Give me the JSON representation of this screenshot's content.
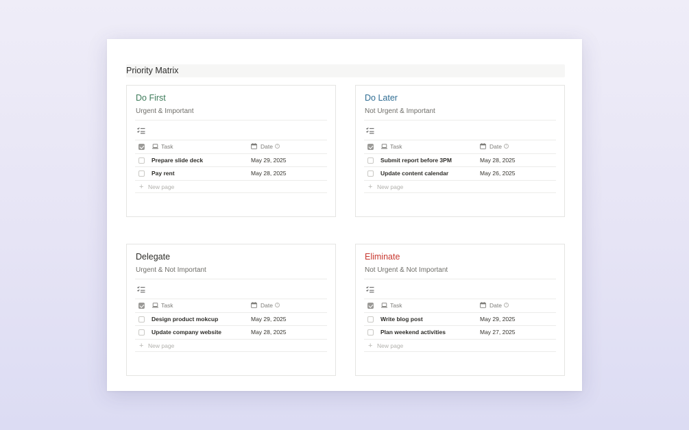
{
  "page": {
    "title": "Priority Matrix"
  },
  "colors": {
    "do_first": "#3c7a59",
    "do_later": "#2f6d93",
    "delegate": "#2d2c28",
    "eliminate": "#c8372f"
  },
  "icons": {
    "view": "list-checks-icon",
    "task_column": "laptop-icon",
    "date_column": "calendar-icon",
    "date_info": "info-icon",
    "new_page": "plus-icon"
  },
  "quadrants": [
    {
      "title": "Do First",
      "subtitle": "Urgent & Important",
      "header": {
        "task": "Task",
        "date": "Date"
      },
      "tasks": [
        {
          "name": "Prepare slide deck",
          "date": "May 29, 2025"
        },
        {
          "name": "Pay rent",
          "date": "May 28, 2025"
        }
      ],
      "new_page": "New page"
    },
    {
      "title": "Do Later",
      "subtitle": "Not Urgent & Important",
      "header": {
        "task": "Task",
        "date": "Date"
      },
      "tasks": [
        {
          "name": "Submit report before 3PM",
          "date": "May 28, 2025"
        },
        {
          "name": "Update content calendar",
          "date": "May 26, 2025"
        }
      ],
      "new_page": "New page"
    },
    {
      "title": "Delegate",
      "subtitle": "Urgent & Not Important",
      "header": {
        "task": "Task",
        "date": "Date"
      },
      "tasks": [
        {
          "name": "Design product mokcup",
          "date": "May 29, 2025"
        },
        {
          "name": "Update company website",
          "date": "May 28, 2025"
        }
      ],
      "new_page": "New page"
    },
    {
      "title": "Eliminate",
      "subtitle": "Not Urgent & Not Important",
      "header": {
        "task": "Task",
        "date": "Date"
      },
      "tasks": [
        {
          "name": "Write blog post",
          "date": "May 29, 2025"
        },
        {
          "name": "Plan weekend activities",
          "date": "May 27, 2025"
        }
      ],
      "new_page": "New page"
    }
  ]
}
